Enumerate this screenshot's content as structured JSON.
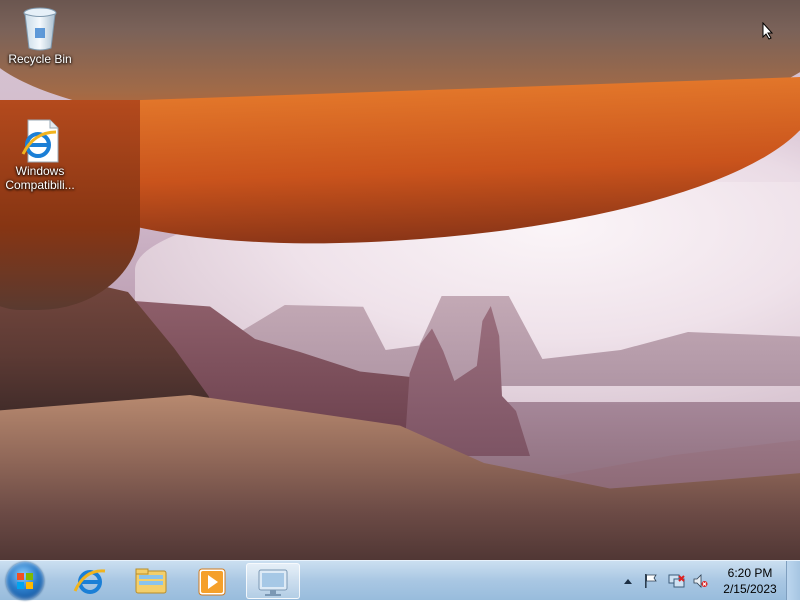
{
  "desktop": {
    "icons": [
      {
        "label": "Recycle Bin",
        "icon": "recycle-bin-icon"
      },
      {
        "label": "Windows Compatibili...",
        "icon": "internet-explorer-icon"
      }
    ]
  },
  "taskbar": {
    "start": {
      "icon": "windows-start-orb-icon"
    },
    "pinned": [
      {
        "icon": "internet-explorer-icon"
      },
      {
        "icon": "file-explorer-folder-icon"
      },
      {
        "icon": "media-player-icon"
      },
      {
        "icon": "remote-desktop-icon",
        "active": true
      }
    ],
    "tray": {
      "icons": [
        "show-hidden-icons-chevron",
        "action-center-flag-icon",
        "network-icon",
        "volume-muted-icon"
      ]
    },
    "clock": {
      "time": "6:20 PM",
      "date": "2/15/2023"
    }
  },
  "colors": {
    "taskbar": "#a9c7e3",
    "start_orb": "#2b7cc9",
    "arch_orange": "#c9531c"
  }
}
